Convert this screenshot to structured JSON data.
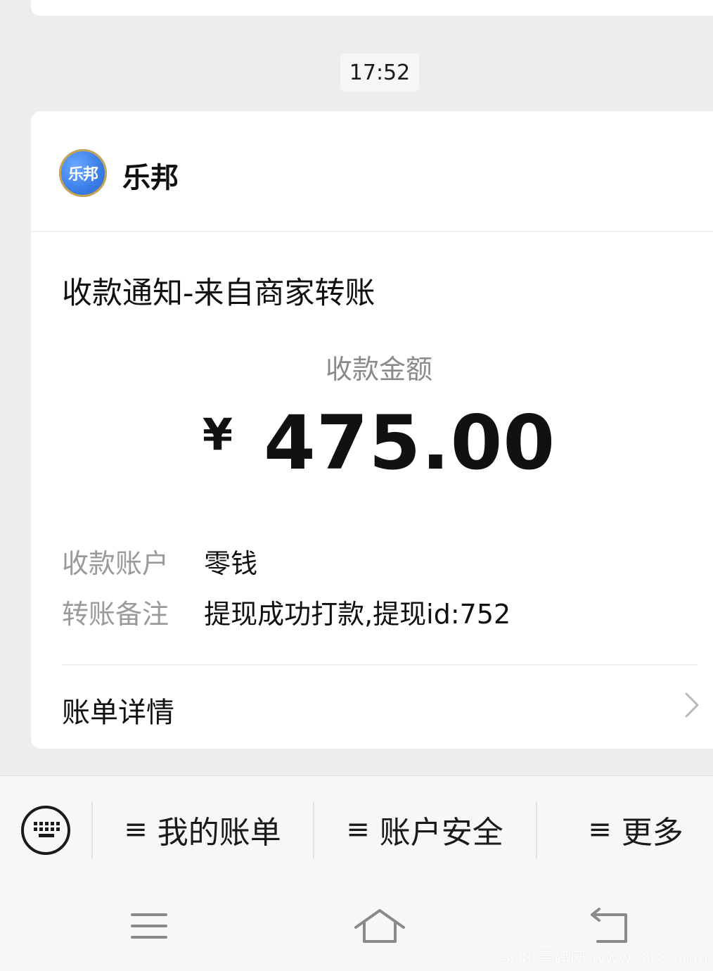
{
  "chat": {
    "timestamp": "17:52"
  },
  "notification": {
    "merchant_logo_text": "乐邦",
    "merchant_name": "乐邦",
    "title": "收款通知-来自商家转账",
    "amount_label": "收款金额",
    "currency_symbol": "¥",
    "amount": "475.00",
    "details": [
      {
        "key": "收款账户",
        "value": "零钱"
      },
      {
        "key": "转账备注",
        "value": "提现成功打款,提现id:752"
      }
    ],
    "bill_link_label": "账单详情"
  },
  "menu": {
    "keyboard_icon": "keyboard-icon",
    "items": [
      {
        "label": "我的账单"
      },
      {
        "label": "账户安全"
      },
      {
        "label": "更多"
      }
    ],
    "item_glyph": "≡"
  },
  "navigation": {
    "icons": [
      "menu-icon",
      "home-icon",
      "back-icon"
    ]
  },
  "watermark": "318 音码网 www.318.com",
  "colors": {
    "background": "#ededed",
    "card": "#ffffff",
    "muted_text": "#9a9a9a",
    "primary_text": "#111111"
  }
}
